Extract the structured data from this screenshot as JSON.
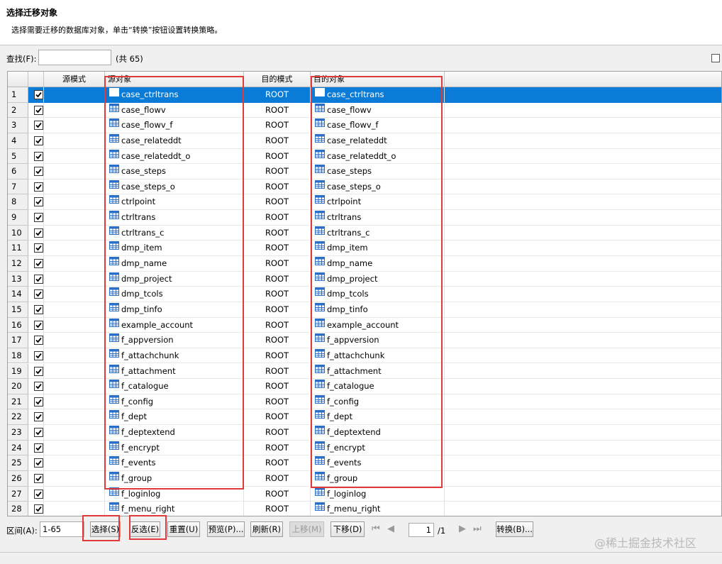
{
  "header": {
    "title": "选择迁移对象",
    "description": "选择需要迁移的数据库对象，单击“转换”按钮设置转换策略。"
  },
  "search": {
    "label": "查找(F):",
    "value": "",
    "count": "(共 65)"
  },
  "columns": [
    "",
    "",
    "源模式",
    "源对象",
    "目的模式",
    "目的对象"
  ],
  "rows": [
    {
      "num": "1",
      "checked": true,
      "src_schema": "",
      "src_object": "case_ctrltrans",
      "dst_schema": "ROOT",
      "dst_object": "case_ctrltrans",
      "selected": true
    },
    {
      "num": "2",
      "checked": true,
      "src_schema": "",
      "src_object": "case_flowv",
      "dst_schema": "ROOT",
      "dst_object": "case_flowv"
    },
    {
      "num": "3",
      "checked": true,
      "src_schema": "",
      "src_object": "case_flowv_f",
      "dst_schema": "ROOT",
      "dst_object": "case_flowv_f"
    },
    {
      "num": "4",
      "checked": true,
      "src_schema": "",
      "src_object": "case_relateddt",
      "dst_schema": "ROOT",
      "dst_object": "case_relateddt"
    },
    {
      "num": "5",
      "checked": true,
      "src_schema": "",
      "src_object": "case_relateddt_o",
      "dst_schema": "ROOT",
      "dst_object": "case_relateddt_o"
    },
    {
      "num": "6",
      "checked": true,
      "src_schema": "",
      "src_object": "case_steps",
      "dst_schema": "ROOT",
      "dst_object": "case_steps"
    },
    {
      "num": "7",
      "checked": true,
      "src_schema": "",
      "src_object": "case_steps_o",
      "dst_schema": "ROOT",
      "dst_object": "case_steps_o"
    },
    {
      "num": "8",
      "checked": true,
      "src_schema": "",
      "src_object": "ctrlpoint",
      "dst_schema": "ROOT",
      "dst_object": "ctrlpoint"
    },
    {
      "num": "9",
      "checked": true,
      "src_schema": "",
      "src_object": "ctrltrans",
      "dst_schema": "ROOT",
      "dst_object": "ctrltrans"
    },
    {
      "num": "10",
      "checked": true,
      "src_schema": "",
      "src_object": "ctrltrans_c",
      "dst_schema": "ROOT",
      "dst_object": "ctrltrans_c"
    },
    {
      "num": "11",
      "checked": true,
      "src_schema": "",
      "src_object": "dmp_item",
      "dst_schema": "ROOT",
      "dst_object": "dmp_item"
    },
    {
      "num": "12",
      "checked": true,
      "src_schema": "",
      "src_object": "dmp_name",
      "dst_schema": "ROOT",
      "dst_object": "dmp_name"
    },
    {
      "num": "13",
      "checked": true,
      "src_schema": "",
      "src_object": "dmp_project",
      "dst_schema": "ROOT",
      "dst_object": "dmp_project"
    },
    {
      "num": "14",
      "checked": true,
      "src_schema": "",
      "src_object": "dmp_tcols",
      "dst_schema": "ROOT",
      "dst_object": "dmp_tcols"
    },
    {
      "num": "15",
      "checked": true,
      "src_schema": "",
      "src_object": "dmp_tinfo",
      "dst_schema": "ROOT",
      "dst_object": "dmp_tinfo"
    },
    {
      "num": "16",
      "checked": true,
      "src_schema": "",
      "src_object": "example_account",
      "dst_schema": "ROOT",
      "dst_object": "example_account"
    },
    {
      "num": "17",
      "checked": true,
      "src_schema": "",
      "src_object": "f_appversion",
      "dst_schema": "ROOT",
      "dst_object": "f_appversion"
    },
    {
      "num": "18",
      "checked": true,
      "src_schema": "",
      "src_object": "f_attachchunk",
      "dst_schema": "ROOT",
      "dst_object": "f_attachchunk"
    },
    {
      "num": "19",
      "checked": true,
      "src_schema": "",
      "src_object": "f_attachment",
      "dst_schema": "ROOT",
      "dst_object": "f_attachment"
    },
    {
      "num": "20",
      "checked": true,
      "src_schema": "",
      "src_object": "f_catalogue",
      "dst_schema": "ROOT",
      "dst_object": "f_catalogue"
    },
    {
      "num": "21",
      "checked": true,
      "src_schema": "",
      "src_object": "f_config",
      "dst_schema": "ROOT",
      "dst_object": "f_config"
    },
    {
      "num": "22",
      "checked": true,
      "src_schema": "",
      "src_object": "f_dept",
      "dst_schema": "ROOT",
      "dst_object": "f_dept"
    },
    {
      "num": "23",
      "checked": true,
      "src_schema": "",
      "src_object": "f_deptextend",
      "dst_schema": "ROOT",
      "dst_object": "f_deptextend"
    },
    {
      "num": "24",
      "checked": true,
      "src_schema": "",
      "src_object": "f_encrypt",
      "dst_schema": "ROOT",
      "dst_object": "f_encrypt"
    },
    {
      "num": "25",
      "checked": true,
      "src_schema": "",
      "src_object": "f_events",
      "dst_schema": "ROOT",
      "dst_object": "f_events"
    },
    {
      "num": "26",
      "checked": true,
      "src_schema": "",
      "src_object": "f_group",
      "dst_schema": "ROOT",
      "dst_object": "f_group"
    },
    {
      "num": "27",
      "checked": true,
      "src_schema": "",
      "src_object": "f_loginlog",
      "dst_schema": "ROOT",
      "dst_object": "f_loginlog"
    },
    {
      "num": "28",
      "checked": true,
      "src_schema": "",
      "src_object": "f_menu_right",
      "dst_schema": "ROOT",
      "dst_object": "f_menu_right"
    }
  ],
  "bottom": {
    "range_label": "区间(A):",
    "range_value": "1-65",
    "buttons": {
      "select": "选择(S)",
      "invert": "反选(E)",
      "reset": "重置(U)",
      "preview": "预览(P)...",
      "refresh": "刷新(R)",
      "move_up": "上移(M)",
      "move_down": "下移(D)",
      "convert": "转换(B)..."
    },
    "page_value": "1",
    "page_total": "/1"
  },
  "watermark": "@稀土掘金技术社区",
  "colors": {
    "selection": "#0a7bd6",
    "highlight_box": "#e03a3a",
    "table_icon": "#2a6fc9"
  },
  "icons": {
    "row_object": "table-icon",
    "checkbox": "checkbox-checked-icon"
  }
}
